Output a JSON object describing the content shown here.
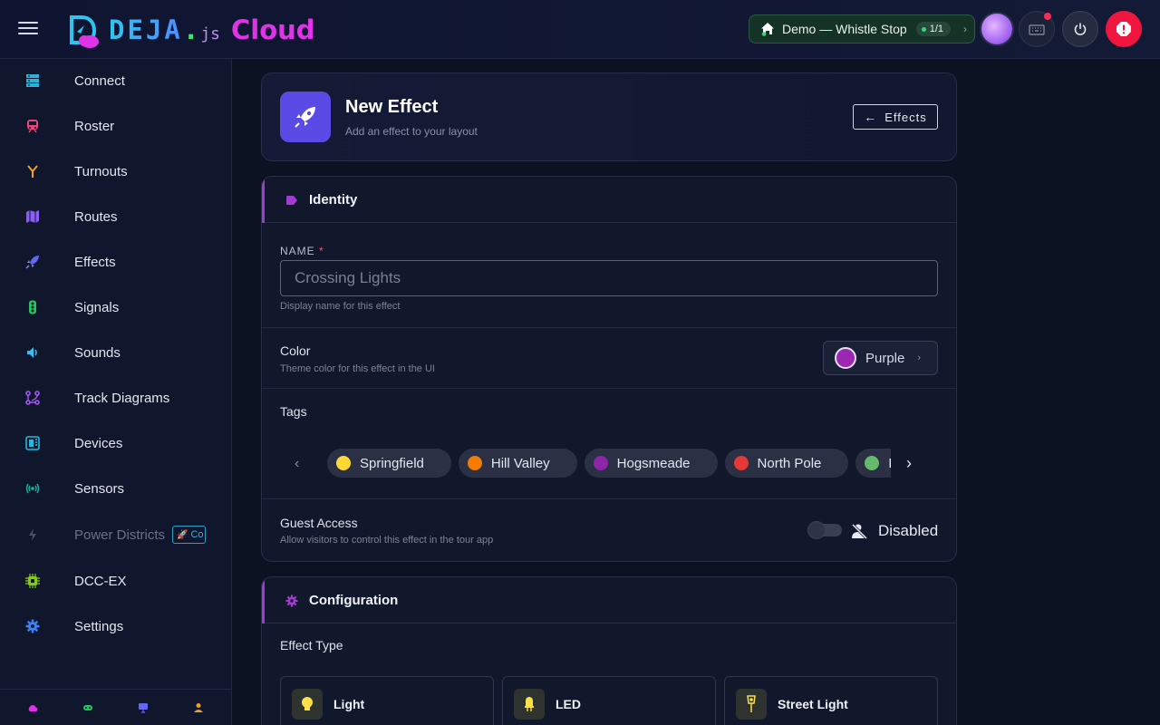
{
  "header": {
    "brand_deja": "DEJA",
    "brand_dot": ".",
    "brand_js": "js",
    "brand_cloud": "Cloud",
    "layout_name": "Demo — Whistle Stop",
    "layout_count": "1/1"
  },
  "sidebar": {
    "items": [
      {
        "label": "Connect",
        "icon": "server-icon",
        "color": "#2ab4d8"
      },
      {
        "label": "Roster",
        "icon": "train-icon",
        "color": "#e8457a"
      },
      {
        "label": "Turnouts",
        "icon": "fork-icon",
        "color": "#f0a020"
      },
      {
        "label": "Routes",
        "icon": "map-icon",
        "color": "#8b5cf6"
      },
      {
        "label": "Effects",
        "icon": "rocket-icon",
        "color": "#6366f1"
      },
      {
        "label": "Signals",
        "icon": "traffic-light-icon",
        "color": "#22c55e"
      },
      {
        "label": "Sounds",
        "icon": "speaker-icon",
        "color": "#38bdf8"
      },
      {
        "label": "Track Diagrams",
        "icon": "diagram-icon",
        "color": "#a855f7"
      },
      {
        "label": "Devices",
        "icon": "chip-board-icon",
        "color": "#22b8e0"
      },
      {
        "label": "Sensors",
        "icon": "radio-waves-icon",
        "color": "#14b8a6"
      },
      {
        "label": "Power Districts",
        "icon": "bolt-icon",
        "color": "#4a4f62",
        "disabled": true,
        "badge": "Co"
      },
      {
        "label": "DCC-EX",
        "icon": "cpu-icon",
        "color": "#84cc16"
      },
      {
        "label": "Settings",
        "icon": "gear-icon",
        "color": "#3b82f6"
      }
    ]
  },
  "page": {
    "title": "New Effect",
    "subtitle": "Add an effect to your layout",
    "back_label": "Effects"
  },
  "identity": {
    "section_title": "Identity",
    "name_label": "NAME",
    "name_required": "*",
    "name_placeholder": "Crossing Lights",
    "name_value": "",
    "name_hint": "Display name for this effect",
    "color_title": "Color",
    "color_hint": "Theme color for this effect in the UI",
    "color_value": "Purple",
    "color_hex": "#9c27b0",
    "tags_title": "Tags",
    "tags": [
      {
        "label": "Springfield",
        "color": "#fdd835"
      },
      {
        "label": "Hill Valley",
        "color": "#f57c00"
      },
      {
        "label": "Hogsmeade",
        "color": "#8e24aa"
      },
      {
        "label": "North Pole",
        "color": "#e53935"
      },
      {
        "label": "K",
        "color": "#66bb6a"
      }
    ],
    "guest_title": "Guest Access",
    "guest_hint": "Allow visitors to control this effect in the tour app",
    "guest_status": "Disabled",
    "guest_enabled": false
  },
  "configuration": {
    "section_title": "Configuration",
    "effect_type_label": "Effect Type",
    "types": [
      {
        "label": "Light",
        "icon": "bulb-icon"
      },
      {
        "label": "LED",
        "icon": "led-icon"
      },
      {
        "label": "Street Light",
        "icon": "street-light-icon"
      }
    ]
  }
}
